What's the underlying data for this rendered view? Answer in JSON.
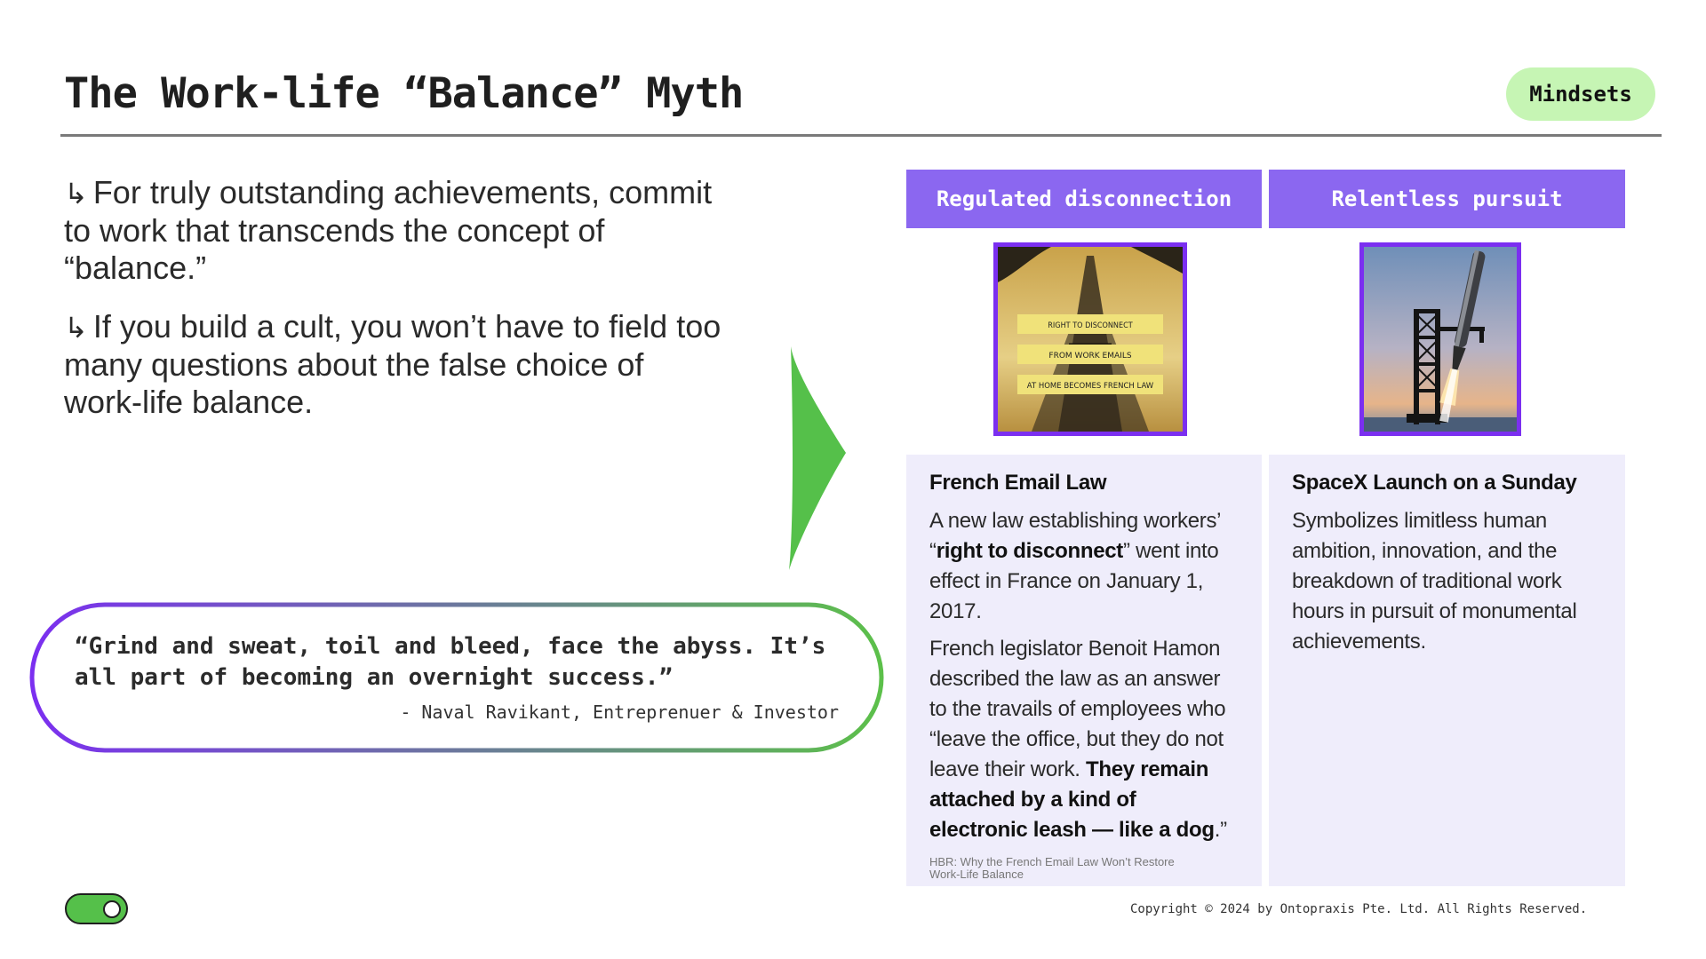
{
  "header": {
    "title": "The Work-life “Balance” Myth",
    "tag": "Mindsets"
  },
  "bullets": [
    {
      "icon": "↳",
      "text": "For truly outstanding achievements, commit to work that transcends the concept of “balance.”"
    },
    {
      "icon": "↳",
      "text": "If you build a cult, you won’t have to field too many questions about the false choice of work-life balance."
    }
  ],
  "quote": {
    "text": "“Grind and sweat, toil and bleed, face the abyss. It’s all part of becoming an overnight success.”",
    "attribution": "- Naval Ravikant, Entreprenuer & Investor"
  },
  "columns": {
    "left": {
      "header": "Regulated disconnection",
      "image_lines": [
        "RIGHT TO DISCONNECT",
        "FROM WORK EMAILS",
        "AT HOME BECOMES FRENCH LAW"
      ],
      "title": "French Email Law",
      "p1_a": "A new law establishing workers’ “",
      "p1_b": "right to disconnect",
      "p1_c": "” went into effect in France on January 1, 2017.",
      "p2_a": "French legislator Benoit Hamon described the law as an answer to the travails of employees who “leave the office, but they do not leave their work. ",
      "p2_b": "They remain attached by a kind of electronic leash — like a dog",
      "p2_c": ".”",
      "source": "HBR: Why the French Email Law Won’t Restore Work-Life Balance"
    },
    "right": {
      "header": "Relentless pursuit",
      "title": "SpaceX Launch on a Sunday",
      "p1": "Symbolizes limitless human ambition, innovation, and the breakdown of traditional work hours in pursuit of monumental achievements."
    }
  },
  "footer": {
    "copyright": "Copyright © 2024 by Ontopraxis Pte. Ltd. All Rights Reserved."
  },
  "colors": {
    "accent_purple": "#8b67f0",
    "frame_purple": "#7b2ff0",
    "green": "#55c04a",
    "tag_bg": "#c6f5b4",
    "panel_bg": "#efedfb"
  }
}
